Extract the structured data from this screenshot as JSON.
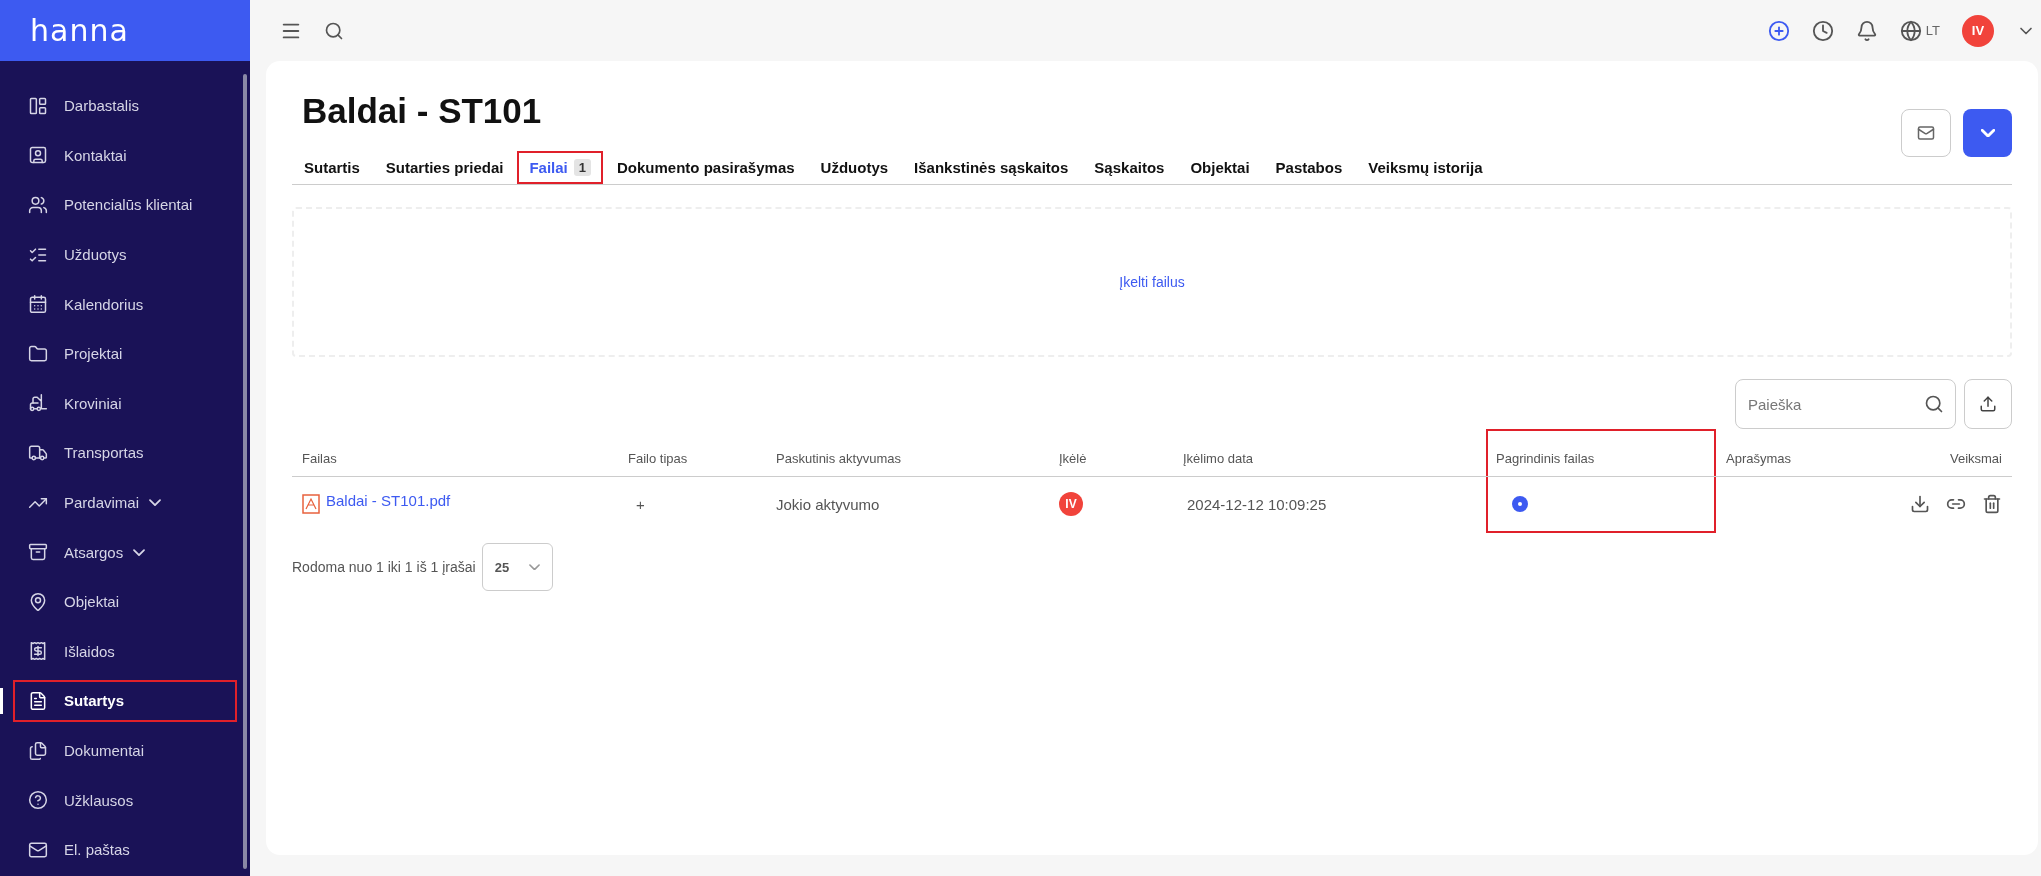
{
  "logo": "hanna",
  "sidebar": {
    "items": [
      {
        "label": "Darbastalis",
        "selected": false,
        "has_submenu": false,
        "highlighted": false
      },
      {
        "label": "Kontaktai",
        "selected": false,
        "has_submenu": false,
        "highlighted": false
      },
      {
        "label": "Potencialūs klientai",
        "selected": false,
        "has_submenu": false,
        "highlighted": false
      },
      {
        "label": "Užduotys",
        "selected": false,
        "has_submenu": false,
        "highlighted": false
      },
      {
        "label": "Kalendorius",
        "selected": false,
        "has_submenu": false,
        "highlighted": false
      },
      {
        "label": "Projektai",
        "selected": false,
        "has_submenu": false,
        "highlighted": false
      },
      {
        "label": "Kroviniai",
        "selected": false,
        "has_submenu": false,
        "highlighted": false
      },
      {
        "label": "Transportas",
        "selected": false,
        "has_submenu": false,
        "highlighted": false
      },
      {
        "label": "Pardavimai",
        "selected": false,
        "has_submenu": true,
        "highlighted": false
      },
      {
        "label": "Atsargos",
        "selected": false,
        "has_submenu": true,
        "highlighted": false
      },
      {
        "label": "Objektai",
        "selected": false,
        "has_submenu": false,
        "highlighted": false
      },
      {
        "label": "Išlaidos",
        "selected": false,
        "has_submenu": false,
        "highlighted": false
      },
      {
        "label": "Sutartys",
        "selected": true,
        "has_submenu": false,
        "highlighted": true
      },
      {
        "label": "Dokumentai",
        "selected": false,
        "has_submenu": false,
        "highlighted": false
      },
      {
        "label": "Užklausos",
        "selected": false,
        "has_submenu": false,
        "highlighted": false
      },
      {
        "label": "El. paštas",
        "selected": false,
        "has_submenu": false,
        "highlighted": false
      }
    ]
  },
  "topbar": {
    "language": "LT",
    "user_initials": "IV"
  },
  "page": {
    "title": "Baldai - ST101"
  },
  "tabs": [
    {
      "label": "Sutartis",
      "selected": false,
      "highlighted": false
    },
    {
      "label": "Sutarties priedai",
      "selected": false,
      "highlighted": false
    },
    {
      "label": "Failai",
      "badge": "1",
      "selected": true,
      "highlighted": true
    },
    {
      "label": "Dokumento pasirašymas",
      "selected": false,
      "highlighted": false
    },
    {
      "label": "Užduotys",
      "selected": false,
      "highlighted": false
    },
    {
      "label": "Išankstinės sąskaitos",
      "selected": false,
      "highlighted": false
    },
    {
      "label": "Sąskaitos",
      "selected": false,
      "highlighted": false
    },
    {
      "label": "Objektai",
      "selected": false,
      "highlighted": false
    },
    {
      "label": "Pastabos",
      "selected": false,
      "highlighted": false
    },
    {
      "label": "Veiksmų istorija",
      "selected": false,
      "highlighted": false
    }
  ],
  "dropzone": {
    "link": "Įkelti failus"
  },
  "search": {
    "placeholder": "Paieška"
  },
  "table": {
    "columns": [
      {
        "label": "Failas",
        "highlighted": false
      },
      {
        "label": "Failo tipas",
        "highlighted": false
      },
      {
        "label": "Paskutinis aktyvumas",
        "highlighted": false
      },
      {
        "label": "Įkėlė",
        "highlighted": false
      },
      {
        "label": "Įkėlimo data",
        "highlighted": false
      },
      {
        "label": "Pagrindinis failas",
        "highlighted": true
      },
      {
        "label": "Aprašymas",
        "highlighted": false
      },
      {
        "label": "Veiksmai",
        "highlighted": false
      }
    ],
    "rows": [
      {
        "file": "Baldai - ST101.pdf",
        "type": "+",
        "activity": "Jokio aktyvumo",
        "uploader": "IV",
        "date": "2024-12-12 10:09:25",
        "main_file": true
      }
    ]
  },
  "pagination": {
    "summary": "Rodoma nuo 1 iki 1 iš 1 įrašai",
    "page_size": "25"
  }
}
